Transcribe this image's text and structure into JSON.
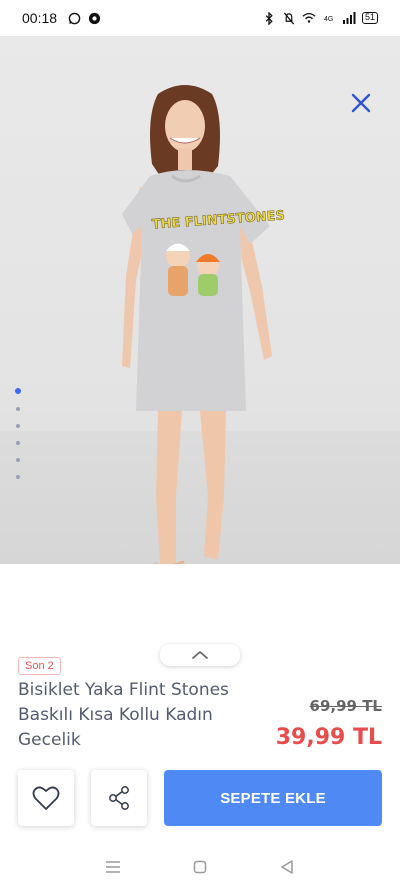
{
  "status_bar": {
    "time": "00:18",
    "battery": "51",
    "icons": [
      "whatsapp-icon",
      "chrome-icon",
      "bluetooth-icon",
      "mute-icon",
      "wifi-icon",
      "volte-icon",
      "signal-icon"
    ]
  },
  "gallery": {
    "image_subject": "THE FLINTSTONES",
    "dots_count": 6,
    "active_dot": 0
  },
  "product": {
    "badge": "Son 2",
    "title": "Bisiklet Yaka Flint Stones Baskılı Kısa Kollu Kadın Gecelik",
    "old_price": "69,99 TL",
    "new_price": "39,99 TL"
  },
  "actions": {
    "cart_label": "SEPETE EKLE"
  },
  "colors": {
    "accent": "#4f8af4",
    "price_red": "#e84c4c",
    "close_blue": "#2f55d4"
  }
}
